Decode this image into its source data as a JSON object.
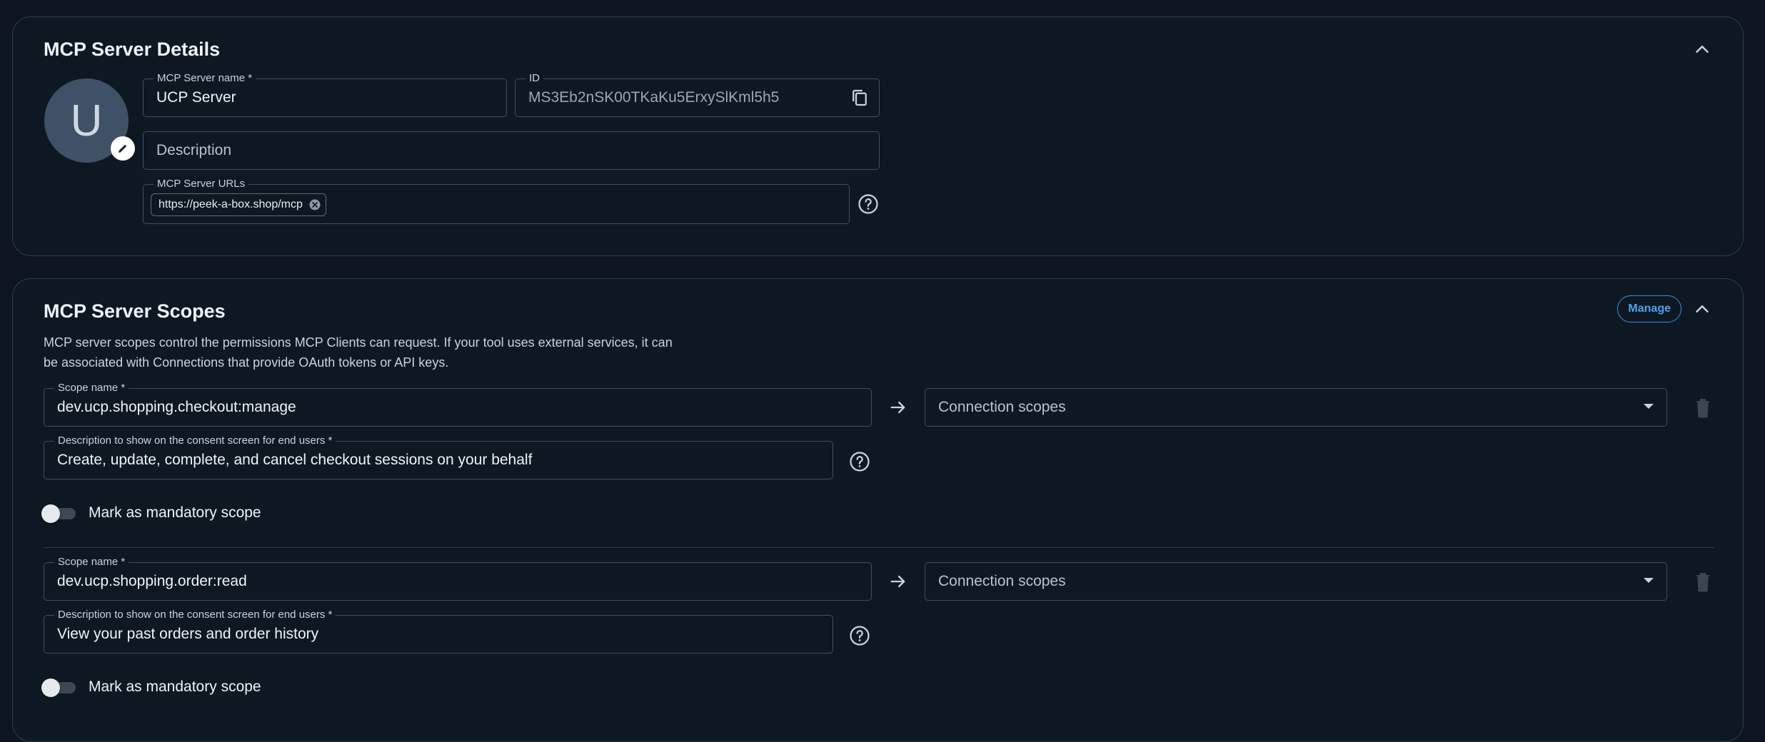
{
  "details": {
    "title": "MCP Server Details",
    "avatar_letter": "U",
    "name_label": "MCP Server name *",
    "name_value": "UCP Server",
    "id_label": "ID",
    "id_value": "MS3Eb2nSK00TKaKu5ErxySlKml5h5",
    "description_placeholder": "Description",
    "urls_label": "MCP Server URLs",
    "url_chip": "https://peek-a-box.shop/mcp"
  },
  "scopes": {
    "title": "MCP Server Scopes",
    "manage_label": "Manage",
    "description": "MCP server scopes control the permissions MCP Clients can request. If your tool uses external services, it can be associated with Connections that provide OAuth tokens or API keys.",
    "items": [
      {
        "scope_label": "Scope name *",
        "scope_value": "dev.ucp.shopping.checkout:manage",
        "connection_placeholder": "Connection scopes",
        "desc_label": "Description to show on the consent screen for end users *",
        "desc_value": "Create, update, complete, and cancel checkout sessions on your behalf",
        "mandatory_label": "Mark as mandatory scope"
      },
      {
        "scope_label": "Scope name *",
        "scope_value": "dev.ucp.shopping.order:read",
        "connection_placeholder": "Connection scopes",
        "desc_label": "Description to show on the consent screen for end users *",
        "desc_value": "View your past orders and order history",
        "mandatory_label": "Mark as mandatory scope"
      }
    ]
  },
  "colors": {
    "background": "#0d1620",
    "border": "#2c3d4b",
    "accent": "#3b8fe0"
  }
}
